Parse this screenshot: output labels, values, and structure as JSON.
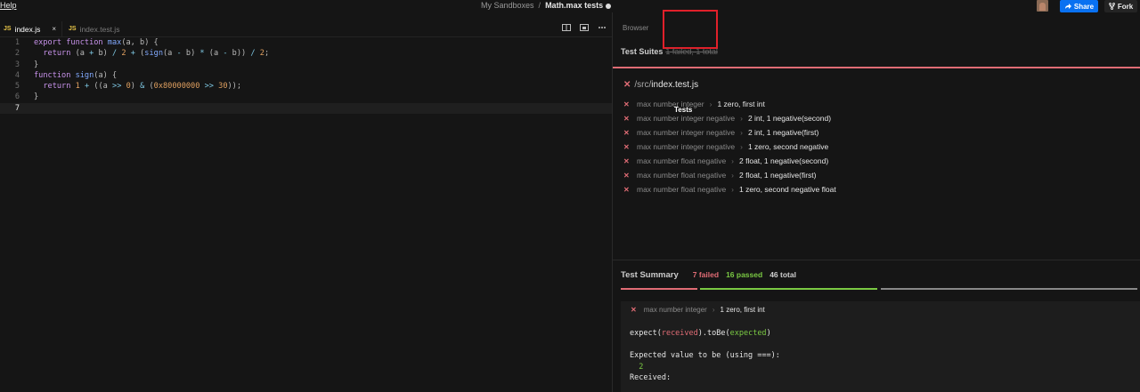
{
  "topbar": {
    "help": "Help",
    "breadcrumb_parent": "My Sandboxes",
    "breadcrumb_sep": "/",
    "title": "Math.max tests",
    "share": "Share",
    "fork": "Fork",
    "share_color": "#0971f1"
  },
  "editor": {
    "tabs": [
      {
        "icon": "JS",
        "label": "index.js",
        "close": "×"
      },
      {
        "icon": "JS",
        "label": "index.test.js"
      }
    ],
    "lines": [
      {
        "n": "1",
        "segs": [
          [
            "kw",
            "export "
          ],
          [
            "kw",
            "function "
          ],
          [
            "fn",
            "max"
          ],
          [
            "pu",
            "(a, b) {"
          ]
        ]
      },
      {
        "n": "2",
        "segs": [
          [
            "kw",
            "  return "
          ],
          [
            "pu",
            "(a "
          ],
          [
            "op",
            "+"
          ],
          [
            "pu",
            " b) "
          ],
          [
            "op",
            "/"
          ],
          [
            "pu",
            " "
          ],
          [
            "num",
            "2"
          ],
          [
            "pu",
            " "
          ],
          [
            "op",
            "+"
          ],
          [
            "pu",
            " ("
          ],
          [
            "fn",
            "sign"
          ],
          [
            "pu",
            "(a "
          ],
          [
            "op",
            "-"
          ],
          [
            "pu",
            " b) "
          ],
          [
            "op",
            "*"
          ],
          [
            "pu",
            " (a "
          ],
          [
            "op",
            "-"
          ],
          [
            "pu",
            " b)) "
          ],
          [
            "op",
            "/"
          ],
          [
            "pu",
            " "
          ],
          [
            "num",
            "2"
          ],
          [
            "pu",
            ";"
          ]
        ]
      },
      {
        "n": "3",
        "segs": [
          [
            "pu",
            "}"
          ]
        ]
      },
      {
        "n": "4",
        "segs": [
          [
            "kw",
            "function "
          ],
          [
            "fn",
            "sign"
          ],
          [
            "pu",
            "(a) {"
          ]
        ]
      },
      {
        "n": "5",
        "segs": [
          [
            "kw",
            "  return "
          ],
          [
            "num",
            "1"
          ],
          [
            "pu",
            " "
          ],
          [
            "op",
            "+"
          ],
          [
            "pu",
            " ((a "
          ],
          [
            "op",
            ">>"
          ],
          [
            "pu",
            " "
          ],
          [
            "num",
            "0"
          ],
          [
            "pu",
            ") "
          ],
          [
            "op",
            "&"
          ],
          [
            "pu",
            " ("
          ],
          [
            "num",
            "0x80000000"
          ],
          [
            "pu",
            " "
          ],
          [
            "op",
            ">>"
          ],
          [
            "pu",
            " "
          ],
          [
            "num",
            "30"
          ],
          [
            "pu",
            "));"
          ]
        ]
      },
      {
        "n": "6",
        "segs": [
          [
            "pu",
            "}"
          ]
        ]
      },
      {
        "n": "7",
        "segs": []
      }
    ]
  },
  "panel": {
    "tabs": [
      "Browser",
      "Tests"
    ],
    "suites_label": "Test Suites",
    "suites_counts": "1 failed, 1 total",
    "file_dir": "/src/",
    "file_name": "index.test.js",
    "tests": [
      {
        "name": "max number integer",
        "case": "1 zero, first int"
      },
      {
        "name": "max number integer negative",
        "case": "2 int, 1 negative(second)"
      },
      {
        "name": "max number integer negative",
        "case": "2 int, 1 negative(first)"
      },
      {
        "name": "max number integer negative",
        "case": "1 zero, second negative"
      },
      {
        "name": "max number float negative",
        "case": "2 float, 1 negative(second)"
      },
      {
        "name": "max number float negative",
        "case": "2 float, 1 negative(first)"
      },
      {
        "name": "max number float negative",
        "case": "1 zero, second negative float"
      }
    ],
    "summary": {
      "label": "Test Summary",
      "failed": "7 failed",
      "passed": "16 passed",
      "total": "46 total",
      "failed_count": 7,
      "passed_count": 16,
      "total_count": 46,
      "colors": {
        "failed": "#e06c75",
        "passed": "#7ac943",
        "pending": "#888888"
      }
    },
    "detail": {
      "name": "max number integer",
      "case": "1 zero, first int",
      "expect_prefix": "expect(",
      "received": "received",
      "mid": ").toBe(",
      "expected": "expected",
      "suffix": ")",
      "expected_label": "Expected value to be (using ===):",
      "expected_value": "2",
      "received_label": "Received:"
    }
  }
}
